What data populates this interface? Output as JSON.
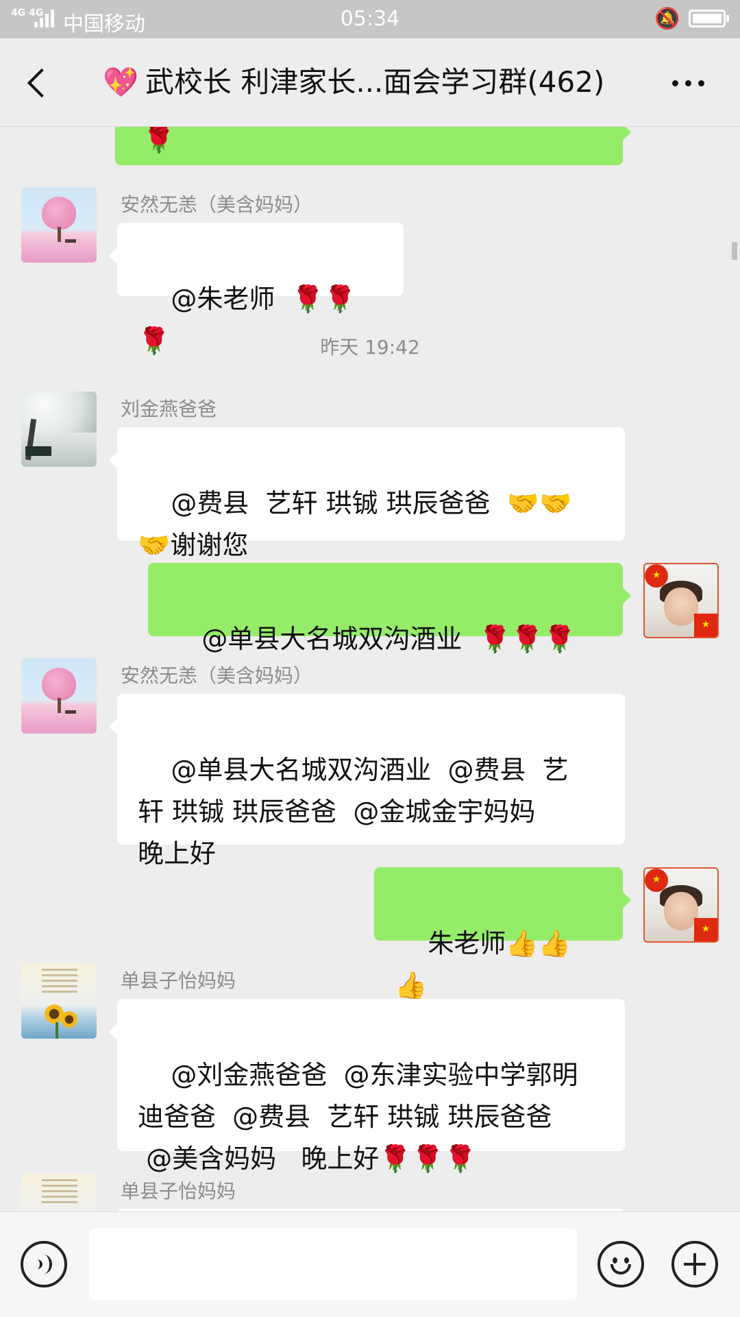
{
  "status_bar": {
    "network": "4G 4G",
    "carrier": "中国移动",
    "time": "05:34"
  },
  "header": {
    "title": "武校长 利津家长...面会学习群(462)",
    "title_emoji": "💖"
  },
  "icons": {
    "back": "chevron-left-icon",
    "more": "more-dots-icon",
    "voice": "voice-icon",
    "emoji": "emoji-icon",
    "add": "plus-icon"
  },
  "colors": {
    "outgoing_bubble": "#95ec69",
    "incoming_bubble": "#ffffff",
    "background": "#ededed"
  },
  "messages": [
    {
      "type": "out",
      "text": "🌹"
    },
    {
      "type": "in",
      "sender": "安然无恙（美含妈妈）",
      "text": "@朱老师  🌹🌹🌹"
    },
    {
      "type": "time",
      "text": "昨天 19:42"
    },
    {
      "type": "in",
      "sender": "刘金燕爸爸",
      "text": "@费县  艺轩 珙铖 珙辰爸爸  🤝🤝\n🤝谢谢您"
    },
    {
      "type": "out",
      "text": "@单县大名城双沟酒业  🌹🌹🌹"
    },
    {
      "type": "in",
      "sender": "安然无恙（美含妈妈）",
      "text": "@单县大名城双沟酒业  @费县  艺\n轩 珙铖 珙辰爸爸  @金城金宇妈妈\n晚上好"
    },
    {
      "type": "out",
      "text": "朱老师👍👍👍"
    },
    {
      "type": "in",
      "sender": "单县子怡妈妈",
      "text": "@刘金燕爸爸  @东津实验中学郭明\n迪爸爸  @费县  艺轩 珙铖 珙辰爸爸\n @美含妈妈   晚上好🌹🌹🌹"
    },
    {
      "type": "in",
      "sender": "单县子怡妈妈",
      "text": ""
    }
  ],
  "input": {
    "value": ""
  }
}
